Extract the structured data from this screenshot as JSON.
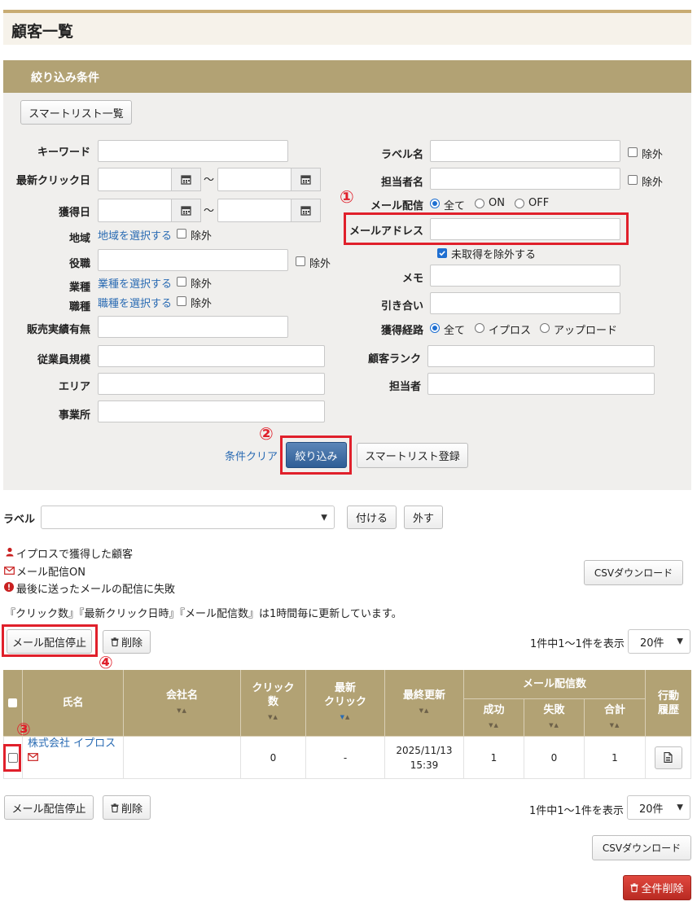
{
  "page": {
    "title": "顧客一覧"
  },
  "filter": {
    "header": "絞り込み条件",
    "smartlist_button": "スマートリスト一覧",
    "left": {
      "keyword": "キーワード",
      "last_click_date": "最新クリック日",
      "acquired_date": "獲得日",
      "range_sep": "～",
      "region": "地域",
      "region_link": "地域を選択する",
      "position": "役職",
      "industry": "業種",
      "industry_link": "業種を選択する",
      "job_type": "職種",
      "job_type_link": "職種を選択する",
      "sales_record": "販売実績有無",
      "employee_size": "従業員規模",
      "area": "エリア",
      "office": "事業所"
    },
    "exclude": "除外",
    "right": {
      "label_name": "ラベル名",
      "owner_name": "担当者名",
      "mail_delivery": "メール配信",
      "mail_options": [
        "全て",
        "ON",
        "OFF"
      ],
      "email_address": "メールアドレス",
      "exclude_unacquired": "未取得を除外する",
      "memo": "メモ",
      "inquiry": "引き合い",
      "acquire_route": "獲得経路",
      "route_options": [
        "全て",
        "イプロス",
        "アップロード"
      ],
      "customer_rank": "顧客ランク",
      "owner": "担当者"
    },
    "clear_link": "条件クリア",
    "search_button": "絞り込み",
    "smartlist_register_button": "スマートリスト登録"
  },
  "label_bar": {
    "label": "ラベル",
    "attach_button": "付ける",
    "remove_button": "外す"
  },
  "legend": {
    "iprs": "イプロスで獲得した顧客",
    "mail_on": "メール配信ON",
    "mail_fail": "最後に送ったメールの配信に失敗"
  },
  "csv_button": "CSVダウンロード",
  "update_note": "『クリック数』『最新クリック日時』『メール配信数』は1時間毎に更新しています。",
  "toolbar": {
    "stop_mail_button": "メール配信停止",
    "delete_button": "削除",
    "count_text": "1件中1～1件を表示",
    "per_page": "20件"
  },
  "table": {
    "headers": {
      "name": "氏名",
      "company": "会社名",
      "clicks": "クリック\n数",
      "last_click": "最新\nクリック",
      "last_update": "最終更新",
      "mail_count": "メール配信数",
      "success": "成功",
      "fail": "失敗",
      "total": "合計",
      "history": "行動\n履歴"
    },
    "rows": [
      {
        "name": "株式会社 イプロス",
        "company": "",
        "clicks": "0",
        "last_click": "-",
        "last_update": "2025/11/13\n15:39",
        "success": "1",
        "fail": "0",
        "total": "1"
      }
    ]
  },
  "delete_all_button": "全件削除",
  "annotations": [
    "①",
    "②",
    "③",
    "④"
  ],
  "colors": {
    "header_bg": "#b2a274",
    "accent_red": "#e0202b",
    "primary_blue": "#2f5e96",
    "link_blue": "#2a6bb3"
  }
}
